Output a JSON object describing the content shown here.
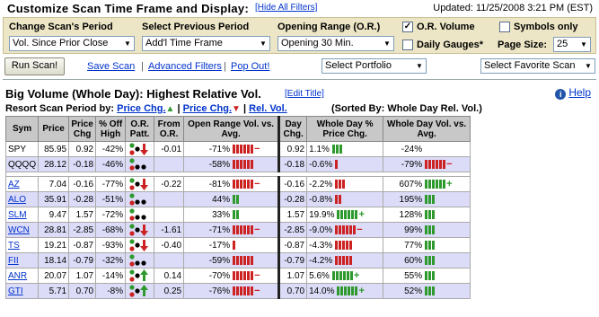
{
  "header": {
    "title": "Customize Scan Time Frame and Display:",
    "hide_filters": "[Hide All Filters]",
    "updated": "Updated: 11/25/2008  3:21 PM (EST)"
  },
  "config": {
    "scan_period_label": "Change Scan's Period",
    "scan_period_value": "Vol. Since Prior Close",
    "prev_period_label": "Select Previous Period",
    "prev_period_value": "Add'l Time Frame",
    "opening_label": "Opening Range (O.R.)",
    "opening_value": "Opening 30 Min.",
    "or_volume_label": "O.R. Volume",
    "or_volume_checked": true,
    "symbols_only_label": "Symbols only",
    "daily_gauges_label": "Daily Gauges*",
    "page_size_label": "Page Size:",
    "page_size_value": "25"
  },
  "toolbar": {
    "run_scan": "Run Scan!",
    "save_scan": "Save Scan",
    "advanced_filters": "Advanced Filters",
    "pop_out": "Pop Out!",
    "portfolio": "Select Portfolio",
    "favorite": "Select Favorite Scan"
  },
  "results": {
    "title": "Big Volume (Whole Day): Highest Relative Vol.",
    "edit_title": "[Edit Title]",
    "help": "Help",
    "resort_label": "Resort Scan Period by:",
    "resort_price": "Price Chg.",
    "resort_rel": "Rel. Vol.",
    "sorted_by": "(Sorted By: Whole Day Rel. Vol.)"
  },
  "columns": [
    "Sym",
    "Price",
    "Price Chg",
    "% Off High",
    "O.R. Patt.",
    "From O.R.",
    "Open Range Vol. vs. Avg.",
    "Day Chg.",
    "Whole Day % Price Chg.",
    "Whole Day Vol. vs. Avg."
  ],
  "colors": {
    "green": "#2e9a2e",
    "red": "#cc2222",
    "grey": "#9a9a9a",
    "header_bg": "#c8c8c8",
    "alt_row": "#dcdcf8"
  },
  "index_rows": [
    {
      "sym": "SPY",
      "price": "85.95",
      "chg": "0.92",
      "off": "-42%",
      "patt": "down",
      "from": "-0.01",
      "or_vol": "-71%",
      "or_bars": "redlong",
      "day": "0.92",
      "pct": "1.1%",
      "pct_bars": "g3",
      "vol": "-24%",
      "vol_bars": ""
    },
    {
      "sym": "QQQQ",
      "price": "28.12",
      "chg": "-0.18",
      "off": "-46%",
      "patt": "flat",
      "from": "",
      "or_vol": "-58%",
      "or_bars": "redmid",
      "day": "-0.18",
      "pct": "-0.6%",
      "pct_bars": "r1",
      "vol": "-79%",
      "vol_bars": "redlong"
    }
  ],
  "rows": [
    {
      "sym": "AZ",
      "price": "7.04",
      "chg": "-0.16",
      "off": "-77%",
      "patt": "down",
      "from": "-0.22",
      "or_vol": "-81%",
      "or_bars": "redlong",
      "day": "-0.16",
      "pct": "-2.2%",
      "pct_bars": "r3",
      "vol": "607%",
      "vol_bars": "g6"
    },
    {
      "sym": "ALO",
      "price": "35.91",
      "chg": "-0.28",
      "off": "-51%",
      "patt": "flat",
      "from": "",
      "or_vol": "44%",
      "or_bars": "g2",
      "day": "-0.28",
      "pct": "-0.8%",
      "pct_bars": "r2",
      "vol": "195%",
      "vol_bars": "g3"
    },
    {
      "sym": "SLM",
      "price": "9.47",
      "chg": "1.57",
      "off": "-72%",
      "patt": "flat",
      "from": "",
      "or_vol": "33%",
      "or_bars": "g2",
      "day": "1.57",
      "pct": "19.9%",
      "pct_bars": "g6",
      "vol": "128%",
      "vol_bars": "g3"
    },
    {
      "sym": "WCN",
      "price": "28.81",
      "chg": "-2.85",
      "off": "-68%",
      "patt": "down",
      "from": "-1.61",
      "or_vol": "-71%",
      "or_bars": "redlong",
      "day": "-2.85",
      "pct": "-9.0%",
      "pct_bars": "r6",
      "vol": "99%",
      "vol_bars": "g3"
    },
    {
      "sym": "TS",
      "price": "19.21",
      "chg": "-0.87",
      "off": "-93%",
      "patt": "down",
      "from": "-0.40",
      "or_vol": "-17%",
      "or_bars": "r1",
      "day": "-0.87",
      "pct": "-4.3%",
      "pct_bars": "r5",
      "vol": "77%",
      "vol_bars": "g3"
    },
    {
      "sym": "FII",
      "price": "18.14",
      "chg": "-0.79",
      "off": "-32%",
      "patt": "flat",
      "from": "",
      "or_vol": "-59%",
      "or_bars": "redmid",
      "day": "-0.79",
      "pct": "-4.2%",
      "pct_bars": "r5",
      "vol": "60%",
      "vol_bars": "g3"
    },
    {
      "sym": "ANR",
      "price": "20.07",
      "chg": "1.07",
      "off": "-14%",
      "patt": "up",
      "from": "0.14",
      "or_vol": "-70%",
      "or_bars": "redlong",
      "day": "1.07",
      "pct": "5.6%",
      "pct_bars": "g6",
      "vol": "55%",
      "vol_bars": "g3"
    },
    {
      "sym": "GTI",
      "price": "5.71",
      "chg": "0.70",
      "off": "-8%",
      "patt": "up",
      "from": "0.25",
      "or_vol": "-76%",
      "or_bars": "redlong",
      "day": "0.70",
      "pct": "14.0%",
      "pct_bars": "g6",
      "vol": "52%",
      "vol_bars": "g3"
    }
  ]
}
